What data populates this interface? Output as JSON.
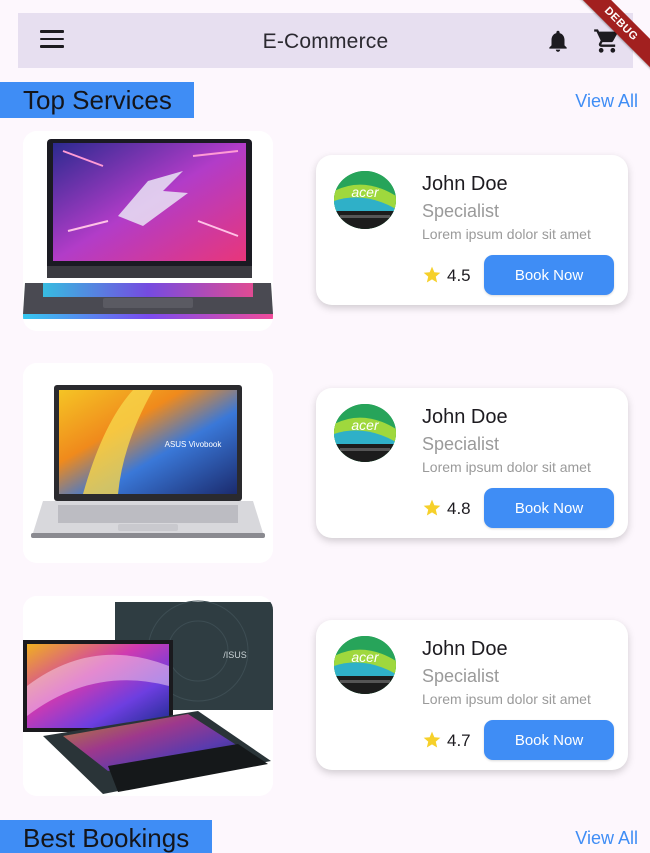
{
  "appbar": {
    "title": "E-Commerce",
    "menu_icon": "menu-icon",
    "bell_icon": "bell-icon",
    "cart_icon": "cart-icon"
  },
  "debug_banner": "DEBUG",
  "sections": {
    "top_services": {
      "title": "Top Services",
      "view_all": "View All"
    },
    "best_bookings": {
      "title": "Best Bookings",
      "view_all": "View All"
    }
  },
  "services": [
    {
      "product": "gaming-laptop-image",
      "name": "John Doe",
      "role": "Specialist",
      "desc": "Lorem ipsum dolor sit amet",
      "rating": "4.5",
      "button": "Book Now"
    },
    {
      "product": "vivobook-laptop-image",
      "name": "John Doe",
      "role": "Specialist",
      "desc": "Lorem ipsum dolor sit amet",
      "rating": "4.8",
      "button": "Book Now"
    },
    {
      "product": "zenbook-duo-laptop-image",
      "name": "John Doe",
      "role": "Specialist",
      "desc": "Lorem ipsum dolor sit amet",
      "rating": "4.7",
      "button": "Book Now"
    }
  ],
  "colors": {
    "accent": "#3f8df5",
    "appbar": "#e7dff0",
    "background": "#fdf7fd",
    "star": "#f6d02a",
    "debug": "#a2201f"
  }
}
